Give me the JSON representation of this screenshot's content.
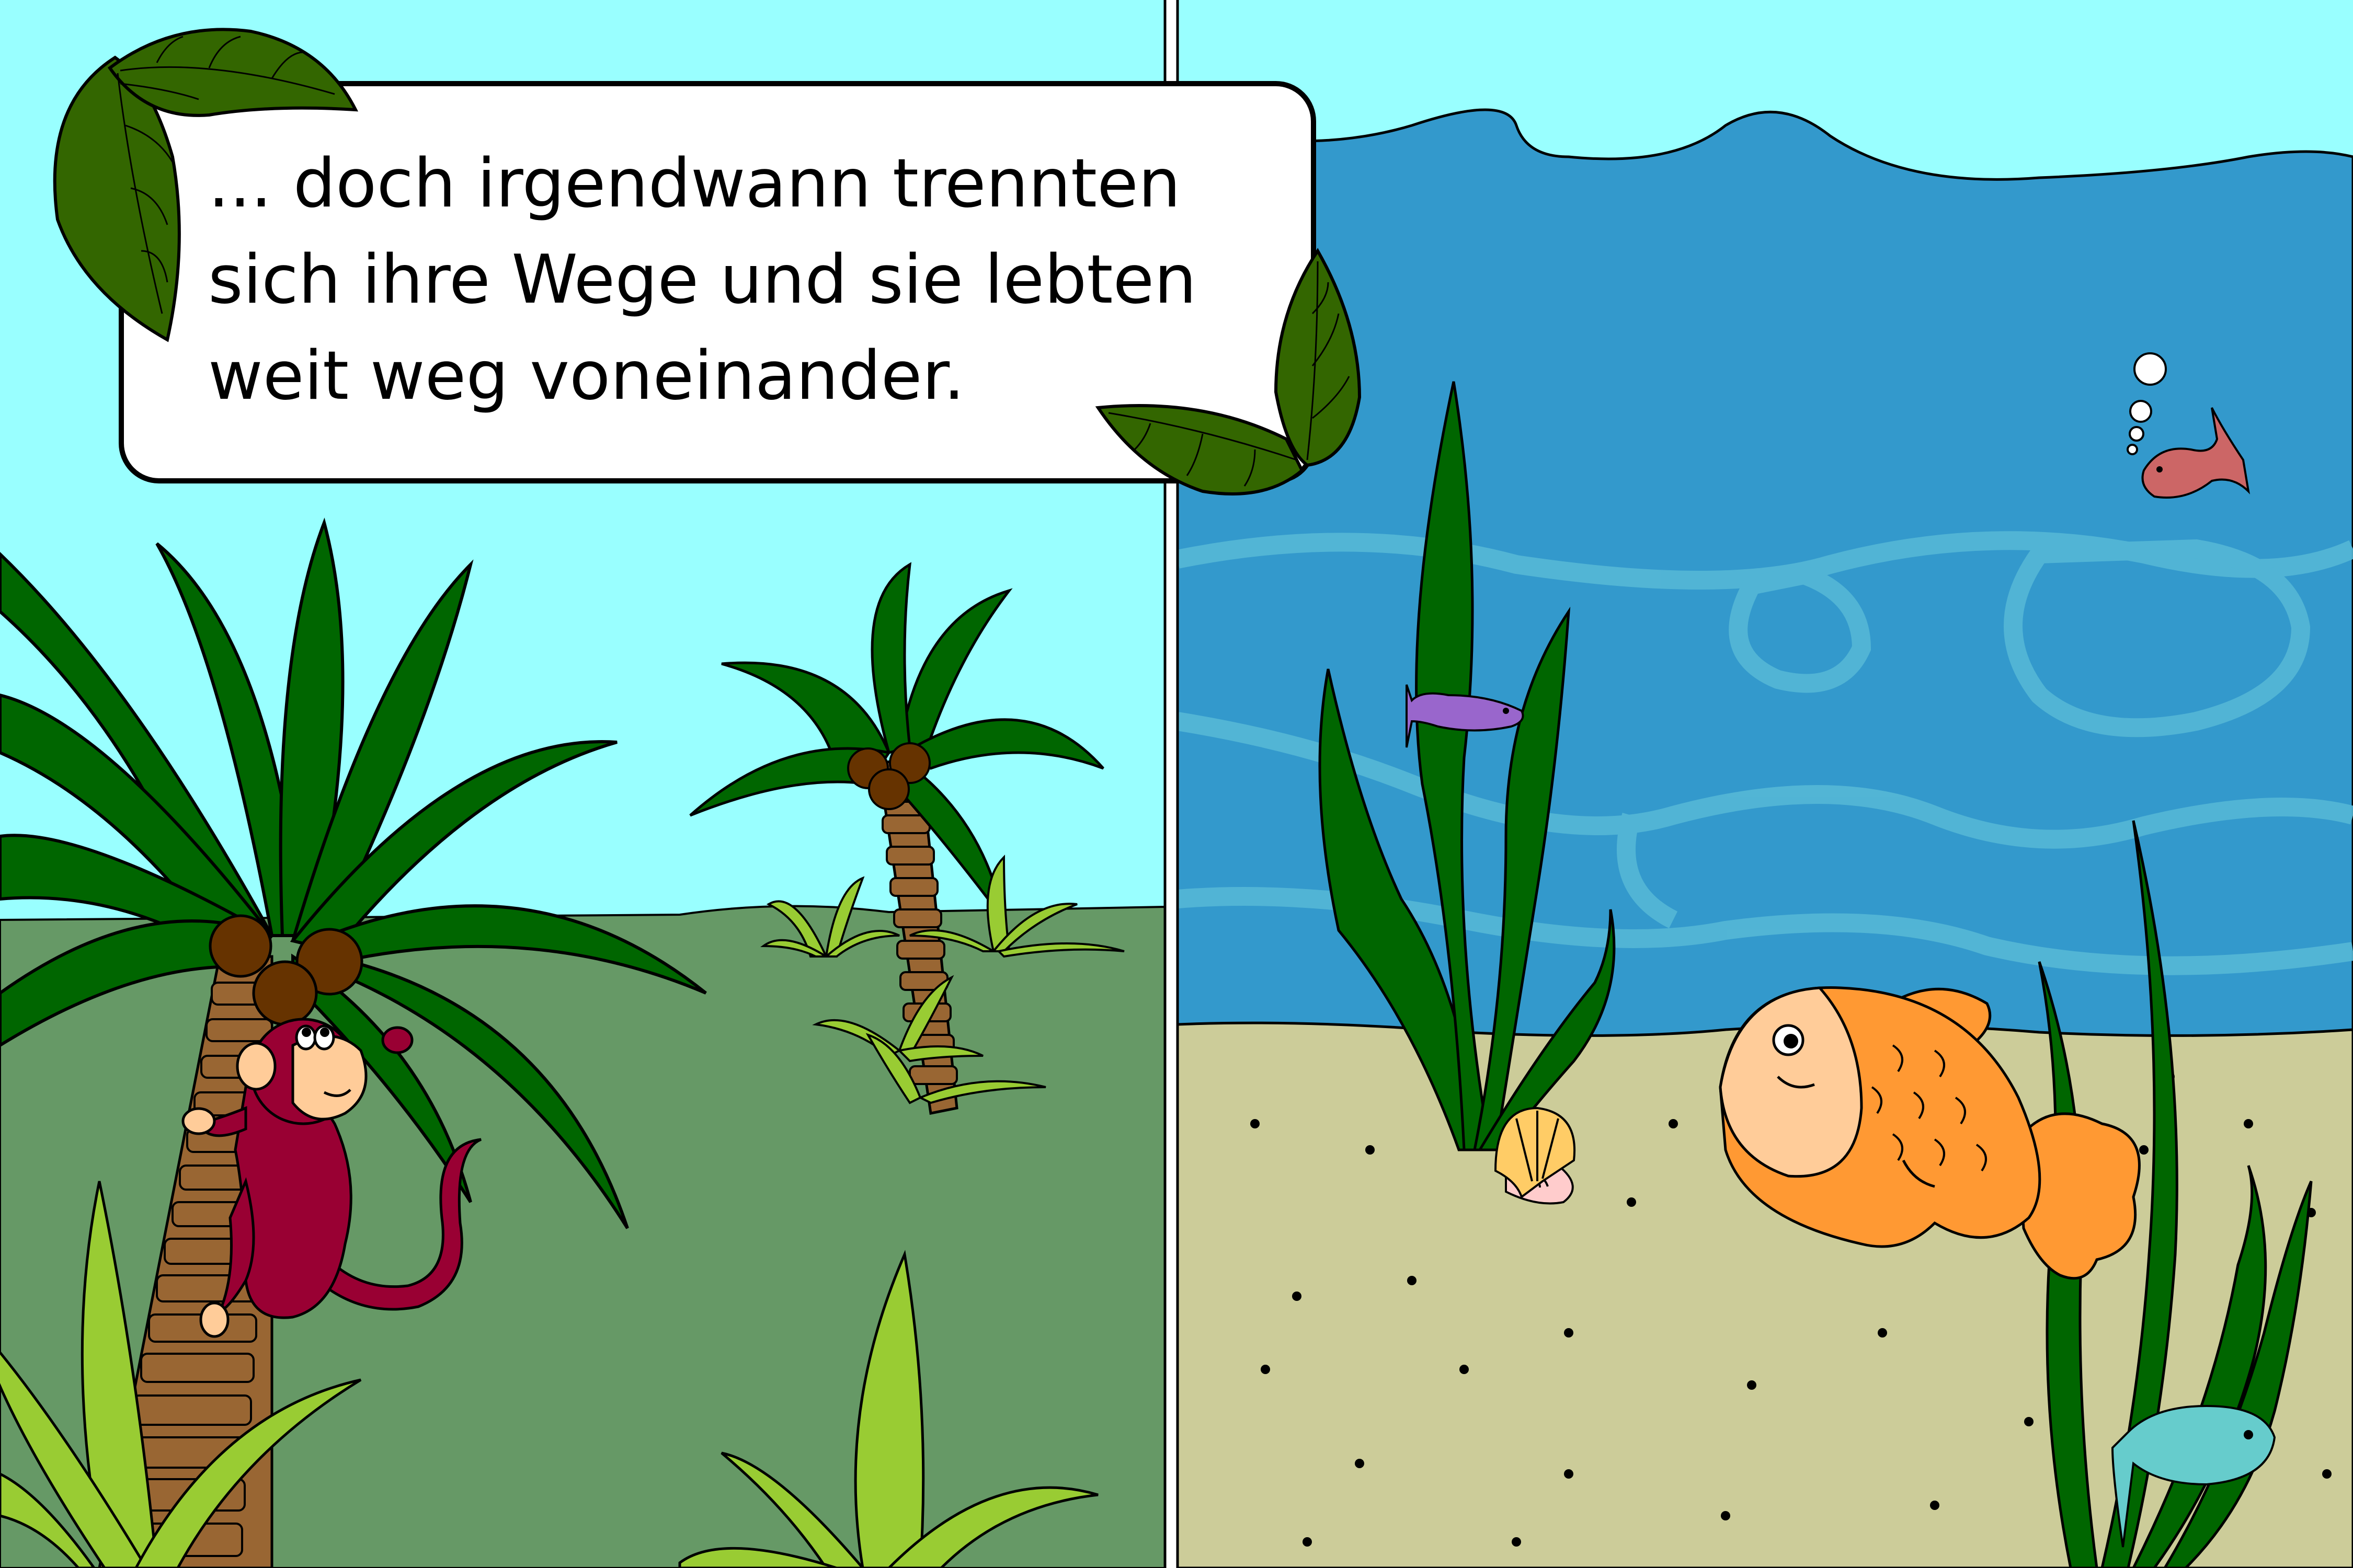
{
  "story": {
    "caption_lines": [
      "... doch irgendwann trennten",
      "sich ihre Wege und sie lebten",
      "weit weg voneinander."
    ]
  },
  "colors": {
    "sky": "#99FFFF",
    "jungle_ground": "#669966",
    "water": "#3399CC",
    "water_light": "#55B8D6",
    "sand": "#CCCC99",
    "palm_leaf": "#006600",
    "trunk": "#996633",
    "coconut": "#663300",
    "monkey": "#990033",
    "monkey_face": "#FFCC99",
    "goldfish": "#FF9933",
    "goldfish_face": "#FFCC99",
    "seaweed": "#006600",
    "fish_purple": "#9966CC",
    "fish_red": "#CC6666",
    "fish_blue": "#66CCCC",
    "bush_light": "#99CC33",
    "bubble": "#ffffff"
  },
  "icons": [
    "leaf-icon",
    "palm-tree-icon",
    "monkey-icon",
    "goldfish-icon",
    "fish-icon",
    "seaweed-icon",
    "shell-icon",
    "bubble-icon"
  ]
}
